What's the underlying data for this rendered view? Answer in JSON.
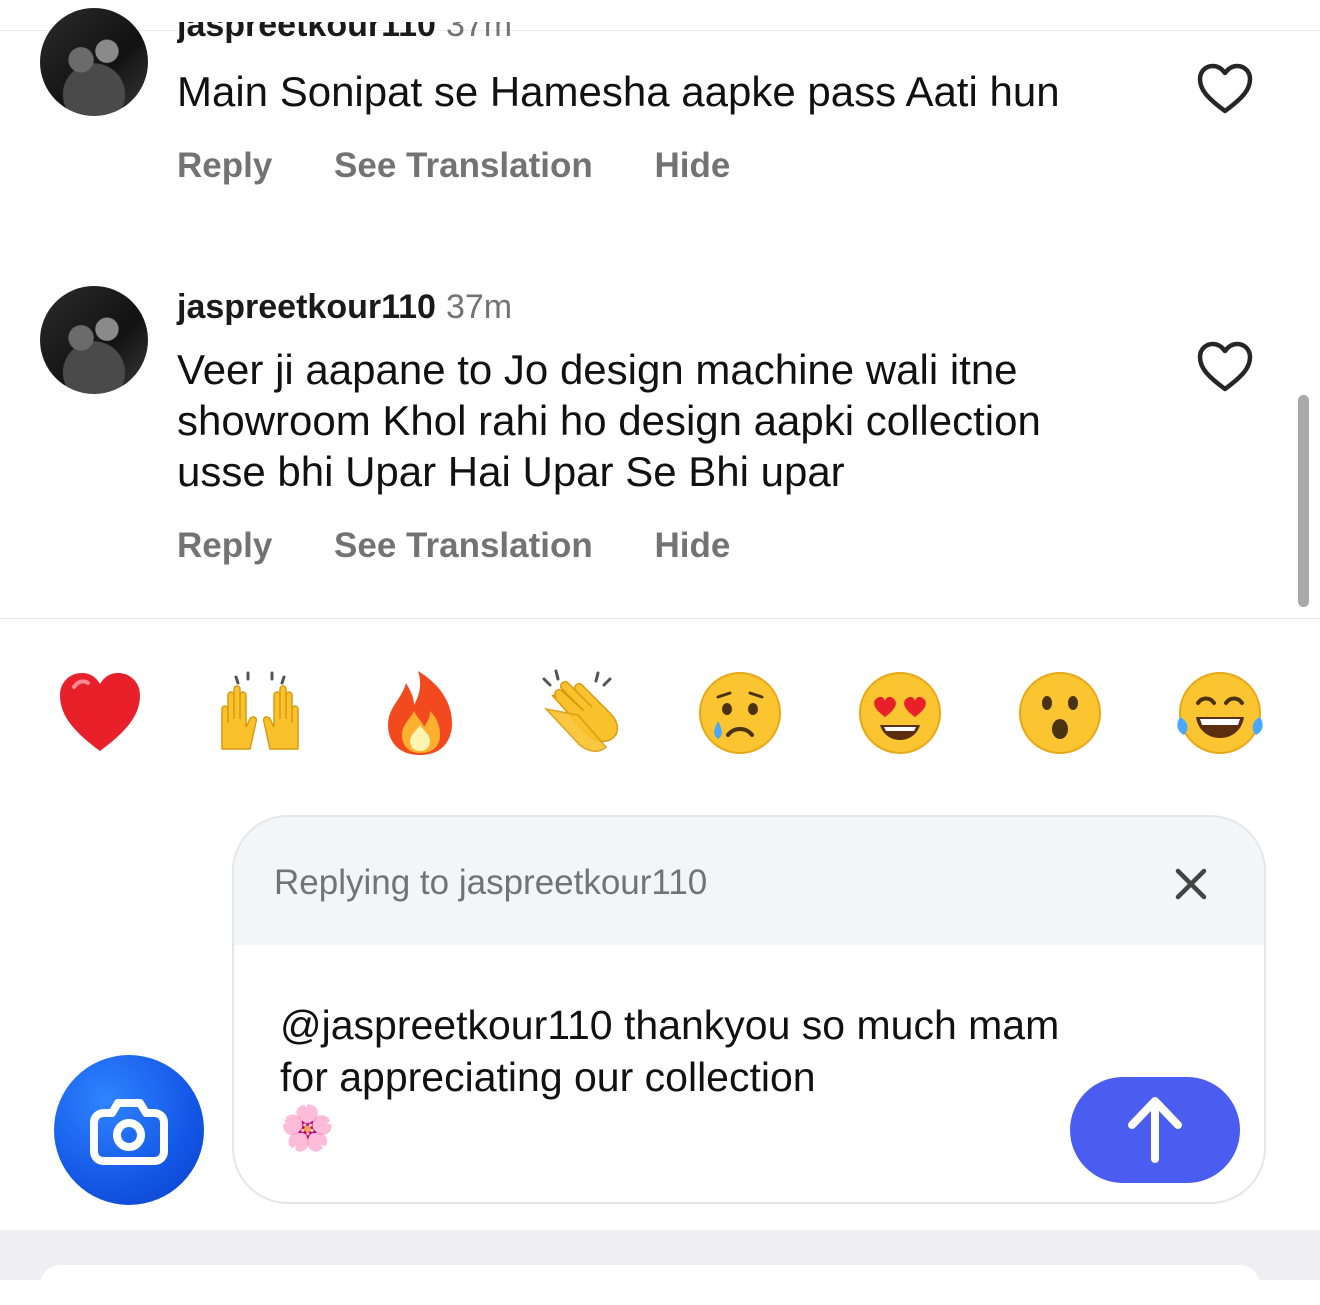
{
  "comments": [
    {
      "username": "jaspreetkour110",
      "time": "37m",
      "text": "Main Sonipat se Hamesha aapke pass Aati hun",
      "actions": {
        "reply": "Reply",
        "translate": "See Translation",
        "hide": "Hide"
      }
    },
    {
      "username": "jaspreetkour110",
      "time": "37m",
      "text": "Veer ji aapane to Jo design machine wali itne showroom Khol rahi ho design aapki collection usse bhi Upar Hai Upar Se Bhi upar",
      "actions": {
        "reply": "Reply",
        "translate": "See Translation",
        "hide": "Hide"
      }
    }
  ],
  "emoji_bar": [
    {
      "name": "red-heart",
      "glyph": "❤️"
    },
    {
      "name": "raising-hands",
      "glyph": "🙌"
    },
    {
      "name": "fire",
      "glyph": "🔥"
    },
    {
      "name": "clapping-hands",
      "glyph": "👏"
    },
    {
      "name": "crying-face",
      "glyph": "😢"
    },
    {
      "name": "heart-eyes",
      "glyph": "😍"
    },
    {
      "name": "surprised-face",
      "glyph": "😮"
    },
    {
      "name": "tears-of-joy",
      "glyph": "😂"
    }
  ],
  "composer": {
    "replying_label": "Replying to jaspreetkour110",
    "text": "@jaspreetkour110 thankyou so much mam for appreciating our collection",
    "text_emoji": "🌸"
  },
  "colors": {
    "accent_send": "#4a5df0",
    "camera_blue": "#1357e6",
    "muted_text": "#737373"
  },
  "icons": {
    "like": "heart-outline-icon",
    "close": "close-icon",
    "send": "arrow-up-icon",
    "camera": "camera-icon"
  }
}
